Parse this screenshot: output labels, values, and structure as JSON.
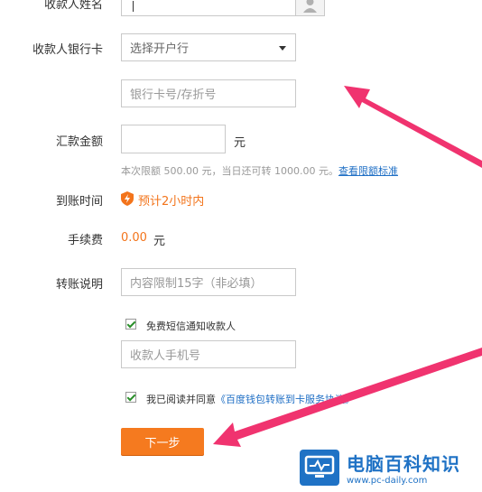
{
  "form": {
    "payee_name_label": "收款人姓名",
    "payee_bank_label": "收款人银行卡",
    "bank_select_placeholder": "选择开户行",
    "card_placeholder": "银行卡号/存折号",
    "amount_label": "汇款金额",
    "amount_unit": "元",
    "limit_hint": "本次限额 500.00 元，当日还可转 1000.00 元。",
    "limit_link": "查看限额标准",
    "arrival_label": "到账时间",
    "arrival_value": "预计2小时内",
    "fee_label": "手续费",
    "fee_value": "0.00",
    "fee_unit": "元",
    "note_label": "转账说明",
    "note_placeholder": "内容限制15字（非必填）",
    "sms_checkbox_label": "免费短信通知收款人",
    "phone_placeholder": "收款人手机号",
    "agree_prefix": "我已阅读并同意",
    "agree_link": "《百度钱包转账到卡服务协议》",
    "next_button": "下一步"
  },
  "watermark": {
    "title": "电脑百科知识",
    "url": "www.pc-daily.com"
  },
  "colors": {
    "accent": "#f57a1f",
    "arrow": "#f0336f",
    "link": "#1f6fc5"
  },
  "icons": [
    "user-icon",
    "chevron-down-icon",
    "shield-icon",
    "checkmark-icon"
  ]
}
